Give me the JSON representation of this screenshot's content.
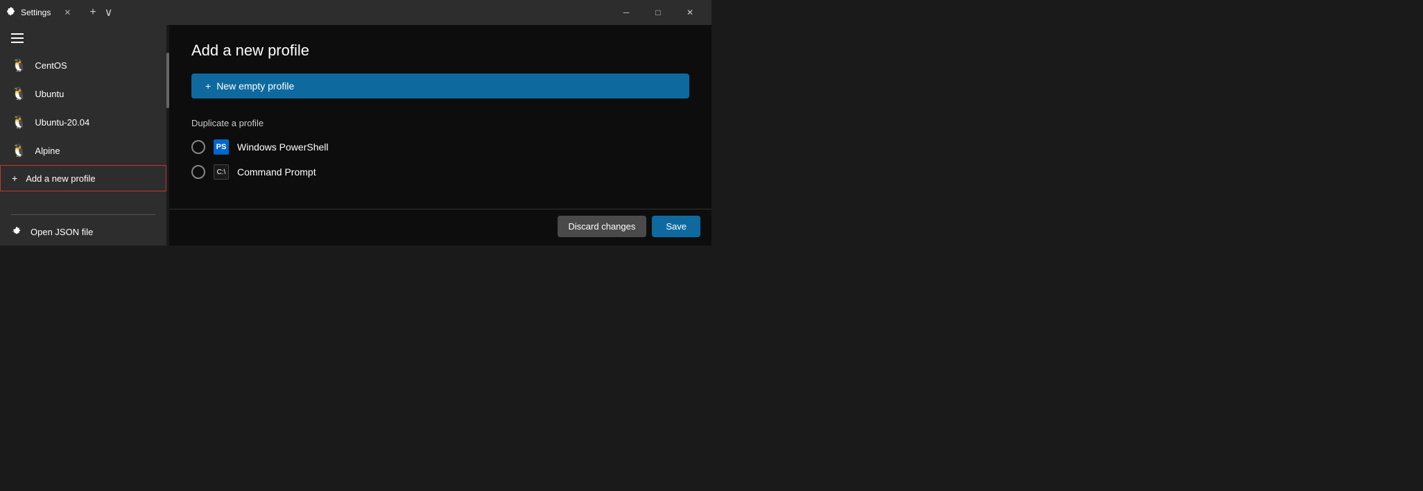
{
  "titlebar": {
    "app_title": "Settings",
    "close_tab_label": "✕",
    "new_tab_label": "+",
    "dropdown_label": "∨",
    "minimize_label": "─",
    "maximize_label": "□",
    "close_window_label": "✕"
  },
  "sidebar": {
    "menu_label": "Menu",
    "items": [
      {
        "id": "centos",
        "label": "CentOS",
        "icon": "🐧"
      },
      {
        "id": "ubuntu",
        "label": "Ubuntu",
        "icon": "🐧"
      },
      {
        "id": "ubuntu2004",
        "label": "Ubuntu-20.04",
        "icon": "🐧"
      },
      {
        "id": "alpine",
        "label": "Alpine",
        "icon": "🐧"
      },
      {
        "id": "add-new",
        "label": "Add a new profile",
        "icon": "+",
        "active": true
      }
    ],
    "bottom": {
      "label": "Open JSON file",
      "icon": "⚙"
    }
  },
  "content": {
    "page_title": "Add a new profile",
    "new_profile_btn": "New empty profile",
    "new_profile_plus": "+",
    "duplicate_label": "Duplicate a profile",
    "profiles": [
      {
        "id": "powershell",
        "name": "Windows PowerShell",
        "icon_type": "ps"
      },
      {
        "id": "cmd",
        "name": "Command Prompt",
        "icon_type": "cmd"
      }
    ],
    "discard_btn": "Discard changes",
    "save_btn": "Save"
  },
  "colors": {
    "accent_blue": "#0e6a9e",
    "sidebar_bg": "#2d2d2d",
    "content_bg": "#0d0d0d",
    "titlebar_bg": "#2d2d2d",
    "active_border": "#cc3333"
  }
}
